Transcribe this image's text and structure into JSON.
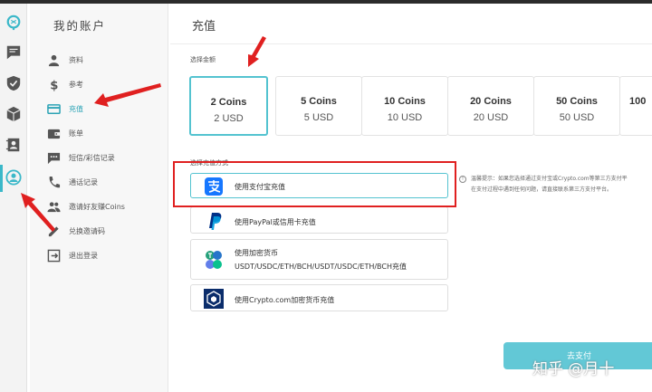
{
  "sidebar": {
    "title": "我的账户",
    "items": [
      {
        "label": "资料",
        "icon": "person-icon"
      },
      {
        "label": "参考",
        "icon": "dollar-icon"
      },
      {
        "label": "充值",
        "icon": "card-icon",
        "active": true
      },
      {
        "label": "账单",
        "icon": "wallet-icon"
      },
      {
        "label": "短信/彩信记录",
        "icon": "chat-icon"
      },
      {
        "label": "通话记录",
        "icon": "phone-icon"
      },
      {
        "label": "邀请好友赚Coins",
        "icon": "people-icon"
      },
      {
        "label": "兑换邀请码",
        "icon": "edit-icon"
      },
      {
        "label": "退出登录",
        "icon": "logout-icon"
      }
    ]
  },
  "main": {
    "title": "充值",
    "amount_label": "选择金额",
    "coins": [
      {
        "coins": "2 Coins",
        "price": "2 USD",
        "selected": true
      },
      {
        "coins": "5 Coins",
        "price": "5 USD"
      },
      {
        "coins": "10 Coins",
        "price": "10 USD"
      },
      {
        "coins": "20 Coins",
        "price": "20 USD"
      },
      {
        "coins": "50 Coins",
        "price": "50 USD"
      },
      {
        "coins": "100",
        "price": ""
      }
    ],
    "method_label": "选择充值方式",
    "methods": [
      {
        "label": "使用支付宝充值",
        "icon": "alipay-icon",
        "selected": true
      },
      {
        "label": "使用PayPal或信用卡充值",
        "icon": "paypal-icon"
      },
      {
        "label": "使用加密货币",
        "label2": "USDT/USDC/ETH/BCH/USDT/USDC/ETH/BCH充值",
        "icon": "crypto-icon"
      },
      {
        "label": "使用Crypto.com加密货币充值",
        "icon": "cryptocom-icon"
      }
    ],
    "tip_line1": "温馨提示：如果您选择通过支付宝或Crypto.com等第三方支付平",
    "tip_line2": "在支付过程中遇到任何问题，请直接联系第三方支付平台。",
    "pay_button": "去支付",
    "watermark": "知乎 @月十"
  },
  "colors": {
    "accent": "#54c3d0",
    "annotation": "#e02020",
    "button": "#62c8d6"
  }
}
